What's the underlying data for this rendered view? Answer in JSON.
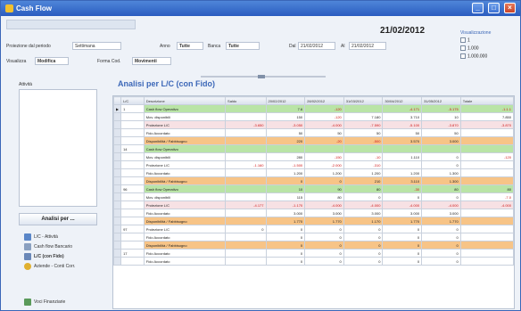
{
  "window": {
    "title": "Cash Flow"
  },
  "header": {
    "date": "21/02/2012",
    "proiezione_label": "Proiezione dal periodo",
    "proiezione_value": "Settimana",
    "anno_label": "Anno",
    "anno_value": "Tutte",
    "banca_label": "Banca",
    "banca_value": "Tutte",
    "dal_label": "Dal",
    "dal_value": "21/02/2012",
    "al_label": "Al",
    "al_value": "21/02/2012",
    "view_label": "Visualizza",
    "view_value": "Modifica",
    "forma_label": "Forma Cod.",
    "forma_value": "Movimenti",
    "checks_title": "Visualizzazione",
    "check_1": "1",
    "check_2": "1.000",
    "check_3": "1.000.000"
  },
  "left": {
    "label": "Attività",
    "analisi_button": "Analisi per ...",
    "menu": [
      {
        "label": "L/C - Attività"
      },
      {
        "label": "Cash flow Bancario"
      },
      {
        "label": "L/C (con Fido)"
      },
      {
        "label": "Aziende - Conti Corr."
      },
      {
        "label": "Voci Finanziarie"
      }
    ]
  },
  "report": {
    "title": "Analisi per L/C (con Fido)",
    "columns": [
      "",
      "L/C",
      "Descrizione",
      "Saldo",
      "20/02/2012",
      "28/02/2012",
      "31/03/2012",
      "30/04/2012",
      "31/05/2012",
      "Totale"
    ],
    "rows": [
      {
        "cls": "green",
        "ind": "▶",
        "lc": "1",
        "desc": "Cash flow Operativo",
        "vals": [
          "",
          "7.6",
          "-120",
          "",
          "-4.171",
          "-5.175",
          "-1.1.1"
        ]
      },
      {
        "cls": "",
        "ind": "",
        "lc": "",
        "desc": "Mov. disponibili",
        "vals": [
          "",
          "150",
          "-120",
          "7.180",
          "3.710",
          "10",
          "7.850"
        ]
      },
      {
        "cls": "pink",
        "ind": "",
        "lc": "",
        "desc": "Proiezione L/C",
        "vals": [
          "-3.650",
          "-3.050",
          "-4.000",
          "-7.590",
          "-5.100",
          "-3.870",
          "-3.870"
        ]
      },
      {
        "cls": "",
        "ind": "",
        "lc": "",
        "desc": "Fido Accordato",
        "vals": [
          "",
          "50",
          "50",
          "50",
          "50",
          "50",
          ""
        ]
      },
      {
        "cls": "orange",
        "ind": "",
        "lc": "",
        "desc": "Disponibilità / Fabbisogno",
        "vals": [
          "",
          "220",
          "-20",
          "-500",
          "3.570",
          "3.000",
          ""
        ]
      },
      {
        "cls": "green",
        "ind": "",
        "lc": "14",
        "desc": "Cash flow Operativo",
        "vals": [
          "",
          "",
          "",
          "",
          "",
          "",
          ""
        ]
      },
      {
        "cls": "",
        "ind": "",
        "lc": "",
        "desc": "Mov. disponibili",
        "vals": [
          "",
          "280",
          "-150",
          "-10",
          "1.110",
          "0",
          "-120"
        ]
      },
      {
        "cls": "",
        "ind": "",
        "lc": "",
        "desc": "Proiezione L/C",
        "vals": [
          "-1.160",
          "-1.500",
          "-2.000",
          "-310",
          "",
          "0",
          ""
        ]
      },
      {
        "cls": "",
        "ind": "",
        "lc": "",
        "desc": "Fido Accordato",
        "vals": [
          "",
          "1.200",
          "1.200",
          "1.200",
          "1.200",
          "1.300",
          ""
        ]
      },
      {
        "cls": "orange",
        "ind": "",
        "lc": "",
        "desc": "Disponibilità / Fabbisogno",
        "vals": [
          "",
          "0",
          "0",
          "210",
          "3.110",
          "1.300",
          ""
        ]
      },
      {
        "cls": "green",
        "ind": "",
        "lc": "96",
        "desc": "Cash flow Operativo",
        "vals": [
          "",
          "10",
          "90",
          "80",
          "-30",
          "80",
          "80"
        ]
      },
      {
        "cls": "",
        "ind": "",
        "lc": "",
        "desc": "Mov. disponibili",
        "vals": [
          "",
          "115",
          "80",
          "0",
          "0",
          "0",
          "-7.0"
        ]
      },
      {
        "cls": "pink",
        "ind": "",
        "lc": "",
        "desc": "Proiezione L/C",
        "vals": [
          "-4.177",
          "-1.170",
          "-4.000",
          "-4.000",
          "-4.000",
          "-4.000",
          "-4.000"
        ]
      },
      {
        "cls": "",
        "ind": "",
        "lc": "",
        "desc": "Fido Accordato",
        "vals": [
          "",
          "3.000",
          "3.000",
          "3.000",
          "3.000",
          "3.000",
          ""
        ]
      },
      {
        "cls": "orange",
        "ind": "",
        "lc": "",
        "desc": "Disponibilità / Fabbisogno",
        "vals": [
          "",
          "1.770",
          "1.770",
          "1.170",
          "1.770",
          "1.770",
          ""
        ]
      },
      {
        "cls": "",
        "ind": "",
        "lc": "97",
        "desc": "Proiezione L/C",
        "vals": [
          "0",
          "0",
          "0",
          "0",
          "0",
          "0",
          ""
        ]
      },
      {
        "cls": "",
        "ind": "",
        "lc": "",
        "desc": "Fido Accordato",
        "vals": [
          "",
          "0",
          "0",
          "0",
          "0",
          "0",
          ""
        ]
      },
      {
        "cls": "orange",
        "ind": "",
        "lc": "",
        "desc": "Disponibilità / Fabbisogno",
        "vals": [
          "",
          "0",
          "0",
          "0",
          "0",
          "0",
          ""
        ]
      },
      {
        "cls": "",
        "ind": "",
        "lc": "17",
        "desc": "Fido Accordato",
        "vals": [
          "",
          "0",
          "0",
          "0",
          "0",
          "0",
          ""
        ]
      },
      {
        "cls": "",
        "ind": "",
        "lc": "",
        "desc": "Fido Accordato",
        "vals": [
          "",
          "0",
          "0",
          "0",
          "0",
          "0",
          ""
        ]
      }
    ]
  },
  "colors": {
    "title_blue": "#3d68b8",
    "green_row": "#b9e4a6",
    "orange_row": "#f7c487",
    "pink_row": "#f7e1e4"
  }
}
